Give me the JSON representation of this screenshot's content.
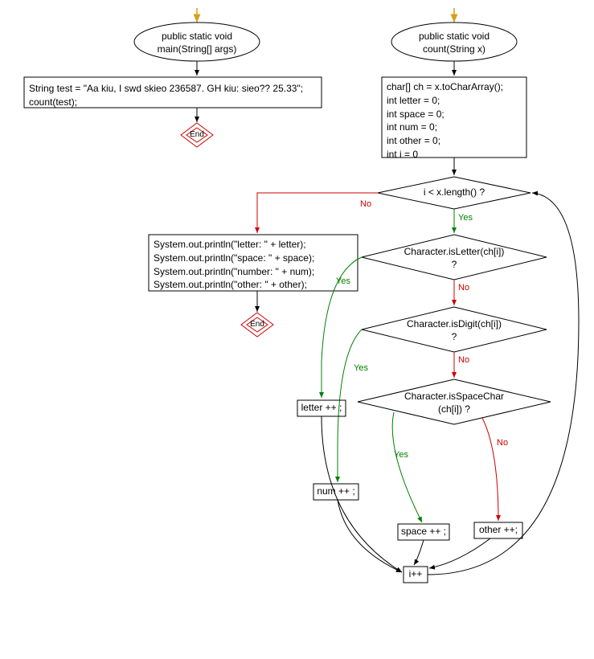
{
  "flowchart": {
    "left_graph": {
      "start_arrow_color": "#d4a017",
      "start_node": "public static void\nmain(String[] args)",
      "body_box": "String test = \"Aa kiu, I swd skieo 236587. GH kiu: sieo?? 25.33\";\ncount(test);",
      "end_label": "End"
    },
    "right_graph": {
      "start_arrow_color": "#d4a017",
      "start_node": "public static void\ncount(String x)",
      "init_box": "char[] ch = x.toCharArray();\nint letter = 0;\nint space = 0;\nint num = 0;\nint other = 0;\nint i = 0",
      "loop_cond": "i < x.length() ?",
      "letter_cond": "Character.isLetter(ch[i])\n?",
      "digit_cond": "Character.isDigit(ch[i])\n?",
      "space_cond": "Character.isSpaceChar\n(ch[i]) ?",
      "print_box": "System.out.println(\"letter: \" + letter);\nSystem.out.println(\"space: \" + space);\nSystem.out.println(\"number: \" + num);\nSystem.out.println(\"other: \" + other);",
      "end_label": "End",
      "letter_inc": "letter ++ ;",
      "num_inc": "num ++ ;",
      "space_inc": "space ++ ;",
      "other_inc": "other ++;",
      "i_inc": "i++"
    },
    "labels": {
      "yes": "Yes",
      "no": "No"
    }
  }
}
